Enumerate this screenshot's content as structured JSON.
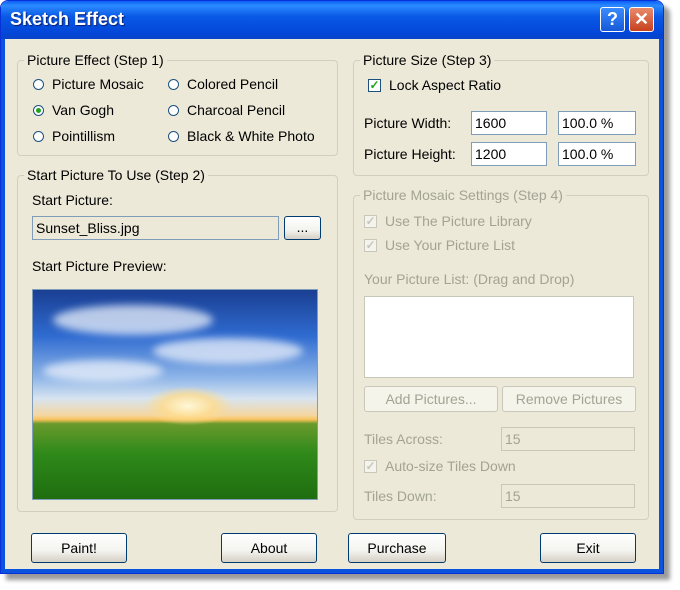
{
  "window": {
    "title": "Sketch Effect"
  },
  "step1": {
    "legend": "Picture Effect (Step 1)",
    "options": [
      {
        "label": "Picture Mosaic",
        "checked": false
      },
      {
        "label": "Colored Pencil",
        "checked": false
      },
      {
        "label": "Van Gogh",
        "checked": true
      },
      {
        "label": "Charcoal Pencil",
        "checked": false
      },
      {
        "label": "Pointillism",
        "checked": false
      },
      {
        "label": "Black & White Photo",
        "checked": false
      }
    ]
  },
  "step2": {
    "legend": "Start Picture To Use (Step 2)",
    "start_picture_label": "Start Picture:",
    "start_picture_value": "Sunset_Bliss.jpg",
    "browse_label": "...",
    "preview_label": "Start Picture Preview:"
  },
  "step3": {
    "legend": "Picture Size (Step 3)",
    "lock_aspect_label": "Lock Aspect Ratio",
    "lock_aspect_checked": true,
    "width_label": "Picture Width:",
    "width_value": "1600",
    "width_percent": "100.0 %",
    "height_label": "Picture Height:",
    "height_value": "1200",
    "height_percent": "100.0 %"
  },
  "step4": {
    "legend": "Picture Mosaic Settings (Step 4)",
    "use_library_label": "Use The Picture Library",
    "use_list_label": "Use Your Picture List",
    "list_label": "Your Picture List: (Drag and Drop)",
    "add_label": "Add Pictures...",
    "remove_label": "Remove Pictures",
    "tiles_across_label": "Tiles Across:",
    "tiles_across_value": "15",
    "autosize_label": "Auto-size Tiles Down",
    "tiles_down_label": "Tiles Down:",
    "tiles_down_value": "15"
  },
  "buttons": {
    "paint": "Paint!",
    "about": "About",
    "purchase": "Purchase",
    "exit": "Exit"
  },
  "colors": {
    "titlebar": "#0a5ae6",
    "window_bg": "#ece9d8",
    "check_green": "#21a121"
  }
}
